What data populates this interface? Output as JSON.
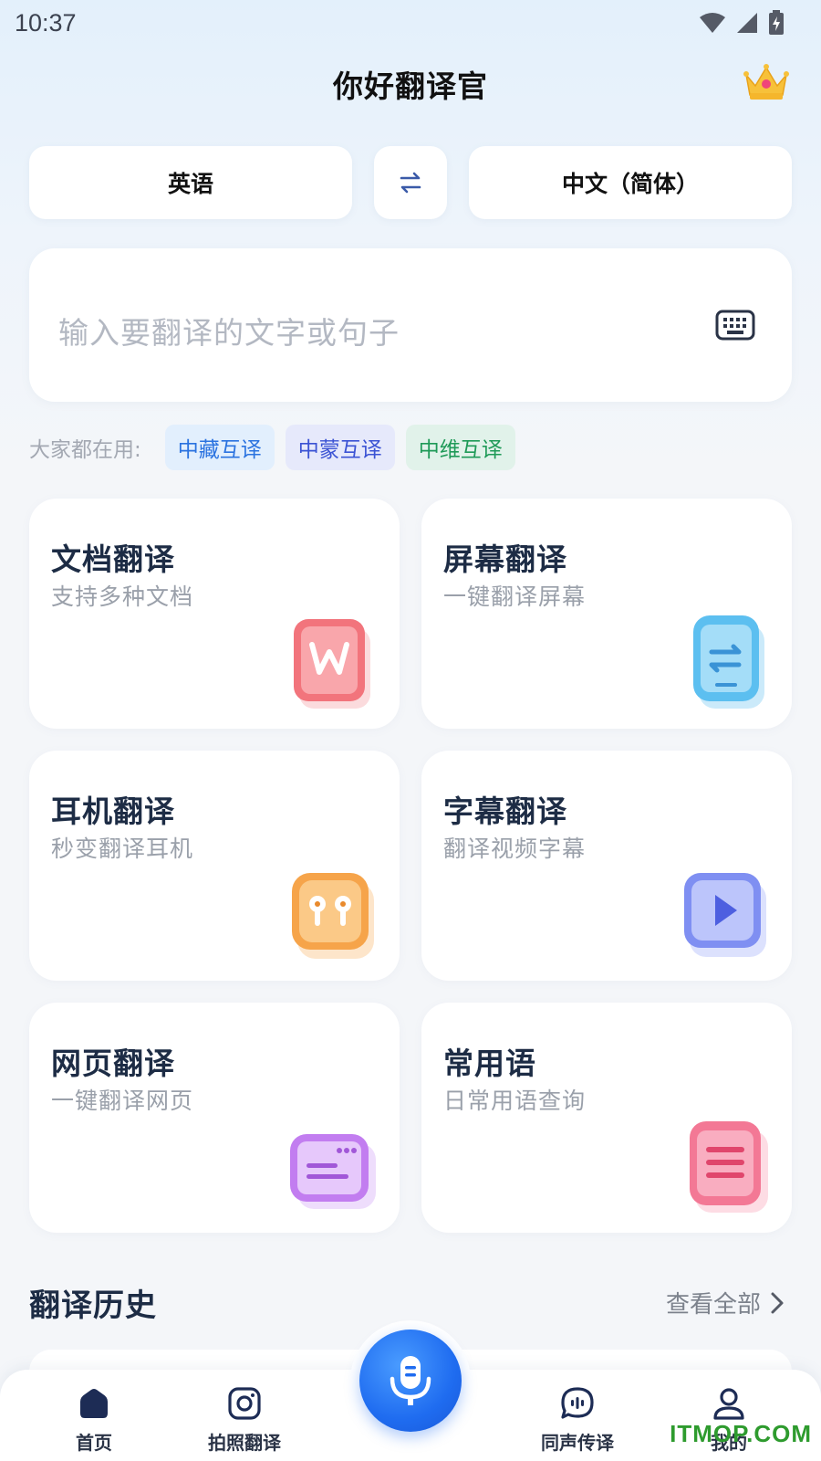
{
  "status_bar": {
    "time": "10:37"
  },
  "header": {
    "title": "你好翻译官"
  },
  "languages": {
    "source": "英语",
    "target": "中文（简体）"
  },
  "input": {
    "placeholder": "输入要翻译的文字或句子"
  },
  "popular": {
    "label": "大家都在用:",
    "chips": [
      "中藏互译",
      "中蒙互译",
      "中维互译"
    ]
  },
  "features": [
    {
      "title": "文档翻译",
      "subtitle": "支持多种文档",
      "icon": "word-document-icon"
    },
    {
      "title": "屏幕翻译",
      "subtitle": "一键翻译屏幕",
      "icon": "phone-swap-icon"
    },
    {
      "title": "耳机翻译",
      "subtitle": "秒变翻译耳机",
      "icon": "earbuds-icon"
    },
    {
      "title": "字幕翻译",
      "subtitle": "翻译视频字幕",
      "icon": "video-play-icon"
    },
    {
      "title": "网页翻译",
      "subtitle": "一键翻译网页",
      "icon": "browser-icon"
    },
    {
      "title": "常用语",
      "subtitle": "日常用语查询",
      "icon": "notes-list-icon"
    }
  ],
  "history": {
    "title": "翻译历史",
    "view_all": "查看全部"
  },
  "tabbar": {
    "home": "首页",
    "photo": "拍照翻译",
    "simultaneous": "同声传译",
    "me": "我的"
  },
  "watermark": "ITMOP.COM",
  "colors": {
    "accent": "#1f6cf0",
    "title": "#1d2c45",
    "chip_tibetan": "#2b73e0",
    "chip_mongolian": "#3b53d4",
    "chip_uyghur": "#1f9a58"
  }
}
